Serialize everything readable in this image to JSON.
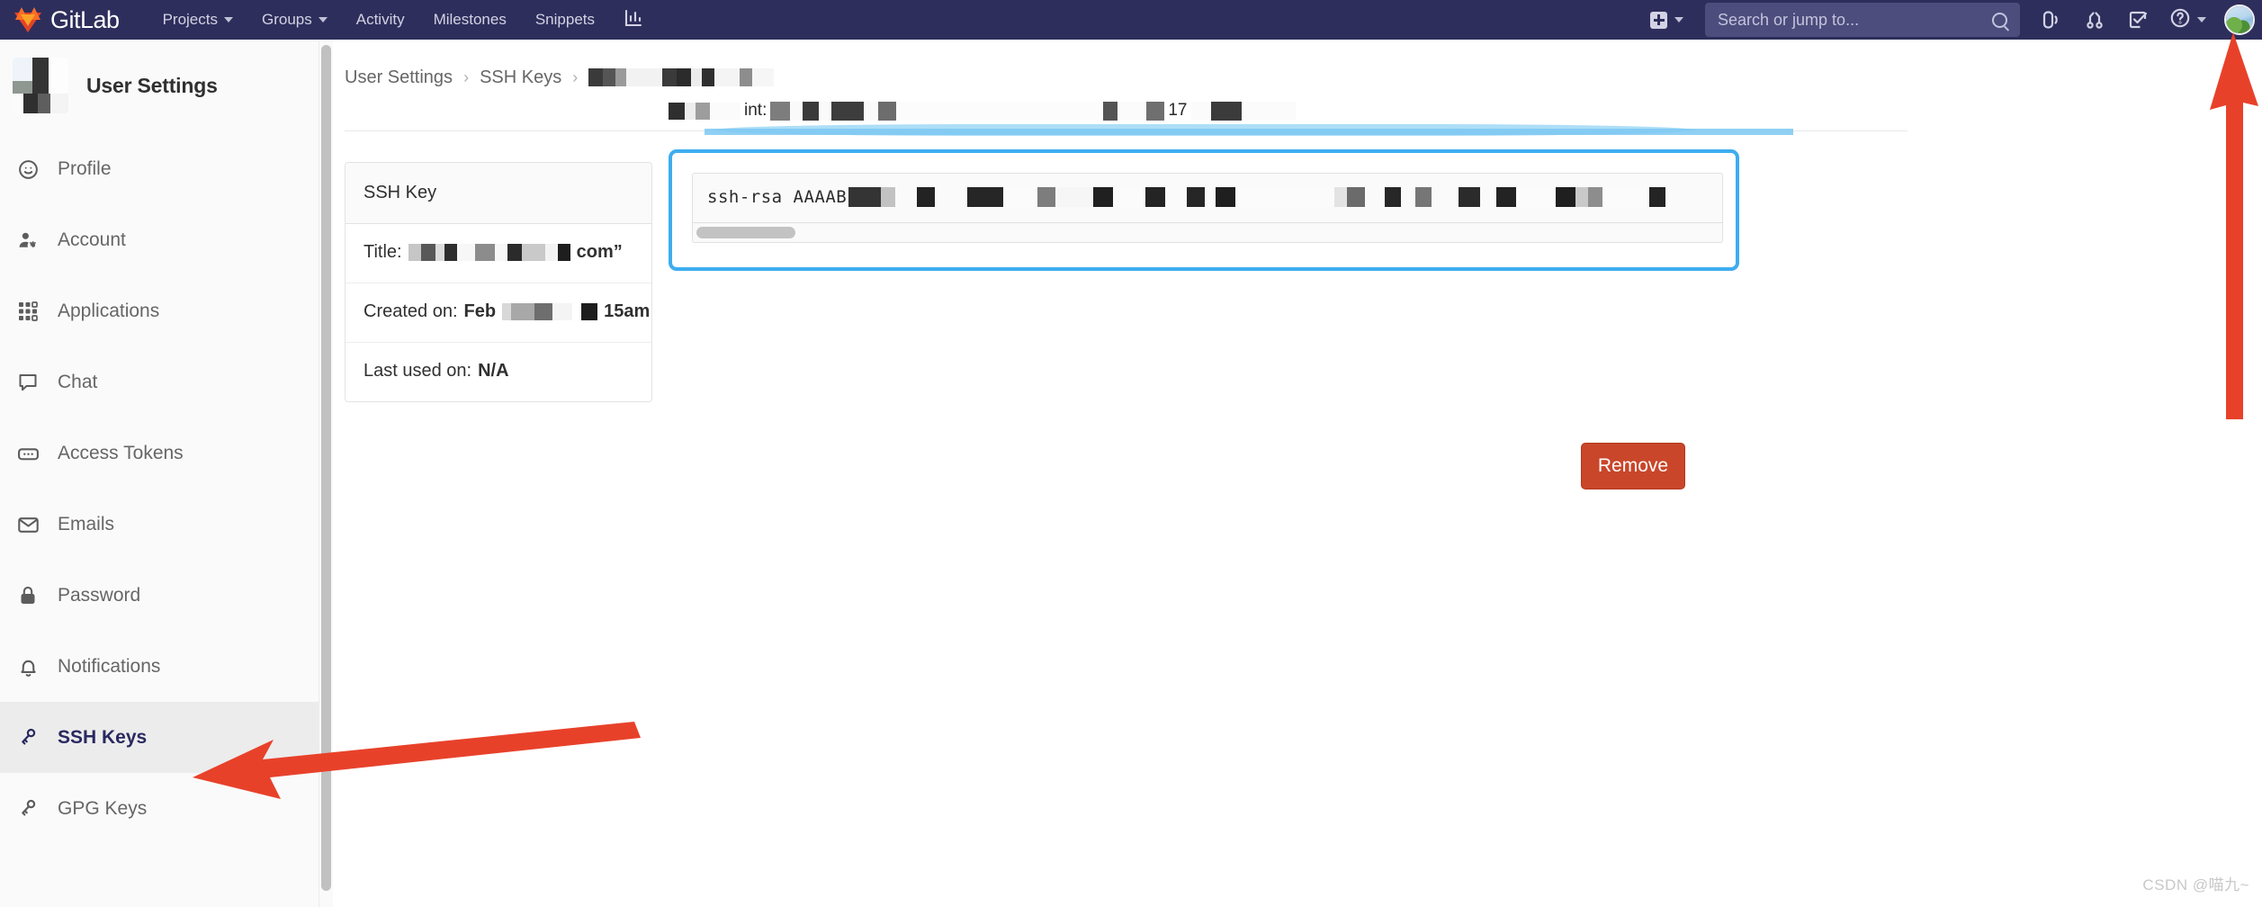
{
  "navbar": {
    "brand": "GitLab",
    "links": [
      {
        "label": "Projects",
        "has_caret": true
      },
      {
        "label": "Groups",
        "has_caret": true
      },
      {
        "label": "Activity",
        "has_caret": false
      },
      {
        "label": "Milestones",
        "has_caret": false
      },
      {
        "label": "Snippets",
        "has_caret": false
      }
    ],
    "analytics_icon": "chart-bar-icon",
    "create_new_icon": "plus-square-icon",
    "create_new_caret": "chevron-down-icon",
    "search": {
      "placeholder": "Search or jump to...",
      "icon": "search-icon",
      "value": ""
    },
    "icons": [
      {
        "name": "issues-icon"
      },
      {
        "name": "merge-requests-icon"
      },
      {
        "name": "todos-icon"
      },
      {
        "name": "help-icon"
      }
    ],
    "help_caret": "chevron-down-icon",
    "avatar": "user-avatar"
  },
  "sidebar": {
    "title": "User Settings",
    "avatar": "user-avatar-blurred",
    "items": [
      {
        "label": "Profile",
        "icon": "user-circle-icon",
        "active": false
      },
      {
        "label": "Account",
        "icon": "user-cog-icon",
        "active": false
      },
      {
        "label": "Applications",
        "icon": "grid-apps-icon",
        "active": false
      },
      {
        "label": "Chat",
        "icon": "comment-icon",
        "active": false
      },
      {
        "label": "Access Tokens",
        "icon": "token-icon",
        "active": false
      },
      {
        "label": "Emails",
        "icon": "envelope-icon",
        "active": false
      },
      {
        "label": "Password",
        "icon": "lock-icon",
        "active": false
      },
      {
        "label": "Notifications",
        "icon": "bell-icon",
        "active": false
      },
      {
        "label": "SSH Keys",
        "icon": "key-icon",
        "active": true
      },
      {
        "label": "GPG Keys",
        "icon": "key-icon",
        "active": false
      }
    ],
    "scrollbar": "vertical-scrollbar"
  },
  "breadcrumb": {
    "items": [
      "User Settings",
      "SSH Keys"
    ],
    "separator": "›",
    "redacted": "[redacted]"
  },
  "card": {
    "header": "SSH Key",
    "rows": [
      {
        "label": "Title:",
        "value": "[redacted]",
        "suffix": "com”"
      },
      {
        "label": "Created on:",
        "value_bold": "Feb",
        "value_redacted": "[redacted]",
        "suffix": "15am"
      },
      {
        "label": "Last used on:",
        "value_bold": "N/A",
        "value_redacted": "",
        "suffix": ""
      }
    ]
  },
  "key_panel": {
    "heading_fragment": "int:",
    "heading_fragment2": "17",
    "highlight_color": "#7cc8f2",
    "textarea": {
      "value_prefix": "ssh-rsa AAAAB",
      "value_redacted": "[redacted public key body]",
      "scrollbar": "horizontal-scrollbar"
    },
    "focus_border_color": "#3eadf0"
  },
  "actions": {
    "remove_label": "Remove",
    "remove_color": "#c9462a"
  },
  "annotations": {
    "arrow_to_sidebar": "red-arrow-pointing-to-ssh-keys",
    "arrow_to_avatar": "red-arrow-pointing-to-avatar",
    "arrow_color": "#e8412a"
  },
  "watermark": "CSDN @喵九~"
}
